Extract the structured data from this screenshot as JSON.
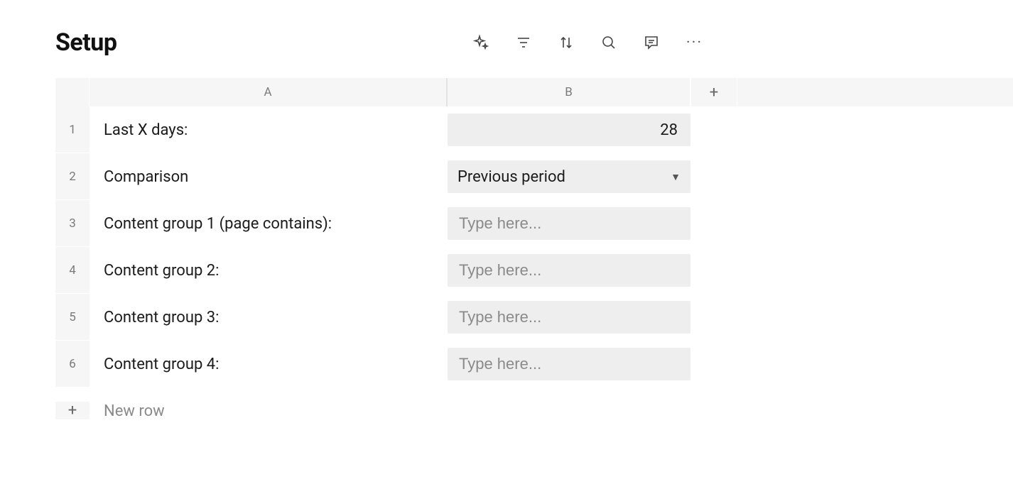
{
  "header": {
    "title": "Setup"
  },
  "columns": {
    "a": "A",
    "b": "B"
  },
  "rows": [
    {
      "num": "1",
      "label": "Last X days:",
      "type": "number",
      "value": "28"
    },
    {
      "num": "2",
      "label": "Comparison",
      "type": "select",
      "value": "Previous period"
    },
    {
      "num": "3",
      "label": "Content group 1 (page contains):",
      "type": "input",
      "placeholder": "Type here..."
    },
    {
      "num": "4",
      "label": "Content group 2:",
      "type": "input",
      "placeholder": "Type here..."
    },
    {
      "num": "5",
      "label": "Content group 3:",
      "type": "input",
      "placeholder": "Type here..."
    },
    {
      "num": "6",
      "label": "Content group 4:",
      "type": "input",
      "placeholder": "Type here..."
    }
  ],
  "newRow": {
    "plus": "+",
    "label": "New row"
  },
  "addColumn": "+"
}
